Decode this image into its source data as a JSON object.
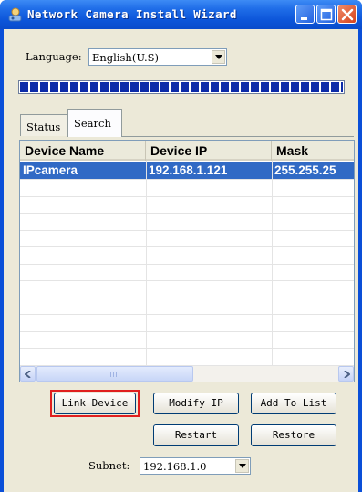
{
  "window": {
    "title": "Network Camera Install Wizard",
    "icon": "camera-app-icon",
    "controls": [
      "minimize-icon",
      "maximize-icon",
      "close-icon"
    ]
  },
  "language": {
    "label": "Language:",
    "selected": "English(U.S)"
  },
  "progress": {
    "percent": 100
  },
  "tabs": [
    {
      "label": "Status",
      "active": false
    },
    {
      "label": "Search",
      "active": true
    }
  ],
  "device_list": {
    "columns": [
      "Device Name",
      "Device IP",
      "Mask"
    ],
    "rows": [
      {
        "name": "IPcamera",
        "ip": "192.168.1.121",
        "mask": "255.255.25",
        "selected": true
      }
    ]
  },
  "buttons": {
    "link_device": "Link Device",
    "modify_ip": "Modify IP",
    "add_to_list": "Add To List",
    "restart": "Restart",
    "restore": "Restore"
  },
  "subnet": {
    "label": "Subnet:",
    "selected": "192.168.1.0"
  },
  "colors": {
    "titlebar": "#0c55d9",
    "selection": "#316ac5",
    "highlight_box": "#e01f1f",
    "progress": "#0c2ba8"
  }
}
